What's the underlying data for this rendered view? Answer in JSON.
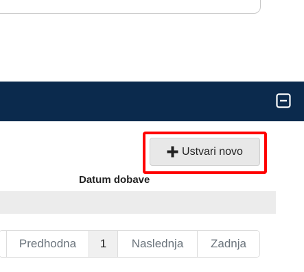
{
  "toolbar": {
    "create_label": "Ustvari novo"
  },
  "table": {
    "columns": [
      "Datum dobave"
    ]
  },
  "pagination": {
    "items": [
      {
        "label": ""
      },
      {
        "label": "Predhodna"
      },
      {
        "label": "1",
        "active": true
      },
      {
        "label": "Naslednja"
      },
      {
        "label": "Zadnja"
      }
    ]
  },
  "colors": {
    "header_bg": "#0b2a4d",
    "highlight": "#ff0000",
    "button_bg": "#e8e8e8",
    "row_bg": "#ececec"
  },
  "icons": {
    "collapse": "minus-square-icon",
    "create": "plus-icon"
  }
}
